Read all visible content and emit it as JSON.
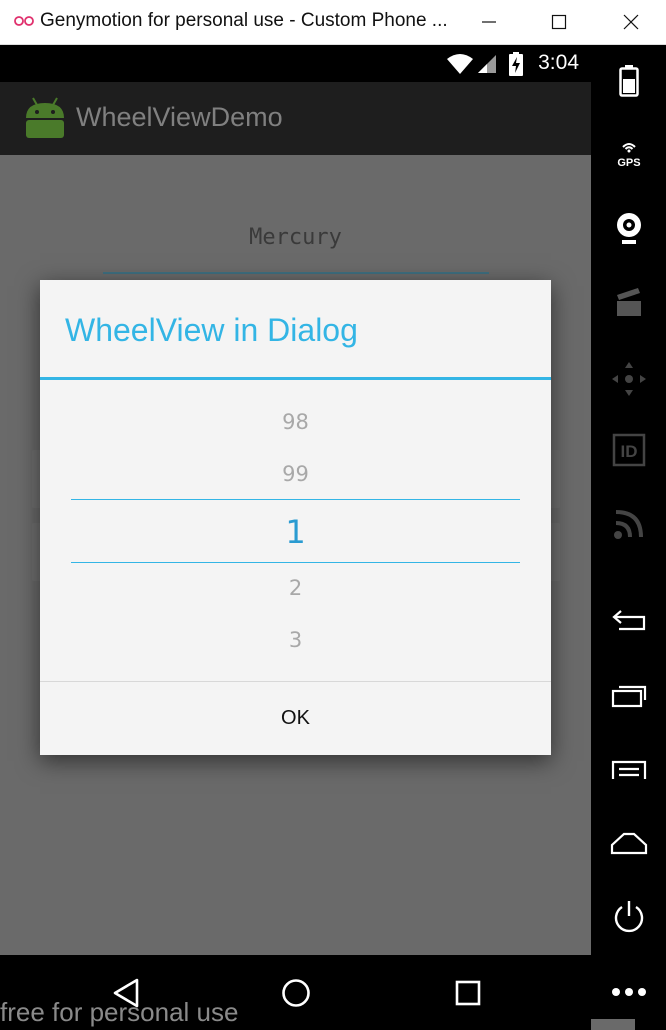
{
  "window": {
    "title": "Genymotion for personal use - Custom Phone ...",
    "app_icon": "genymotion-logo-icon",
    "controls": [
      "minimize-icon",
      "maximize-icon",
      "close-icon"
    ]
  },
  "statusbar": {
    "time": "3:04",
    "icons": [
      "wifi-icon",
      "signal-icon",
      "battery-charging-icon"
    ]
  },
  "app": {
    "title": "WheelViewDemo",
    "background_field_text": "Mercury"
  },
  "dialog": {
    "title": "WheelView in Dialog",
    "wheel_items": [
      "98",
      "99",
      "1",
      "2",
      "3"
    ],
    "selected_value": "1",
    "ok_label": "OK"
  },
  "navbar": {
    "icons": [
      "back-icon",
      "home-icon",
      "recents-icon"
    ]
  },
  "sidepanel": {
    "icons": [
      "battery-icon",
      "gps-icon",
      "webcam-icon",
      "capture-icon",
      "dpad-icon",
      "id-icon",
      "cast-icon",
      "back-icon",
      "recent-apps-icon",
      "menu-icon",
      "home-icon",
      "power-icon",
      "more-icon"
    ],
    "gps_label": "GPS",
    "id_label": "ID"
  },
  "watermark": "free for personal use",
  "colors": {
    "accent": "#33b5e5",
    "selected": "#2a9bd1",
    "dialog_bg": "#f4f4f4",
    "dim_bg": "#6a6a6a"
  }
}
